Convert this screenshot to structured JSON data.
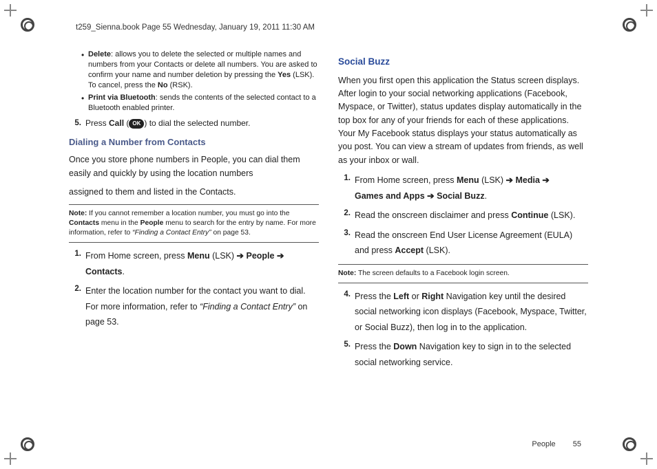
{
  "header": {
    "line": "t259_Sienna.book  Page 55  Wednesday, January 19, 2011  11:30 AM"
  },
  "left": {
    "bullets": [
      {
        "term": "Delete",
        "rest": ": allows you to delete the selected or multiple names and numbers from your Contacts or delete all numbers. You are asked to confirm your name and number deletion by pressing the ",
        "bold2": "Yes",
        "rest2": " (LSK). To cancel, press the ",
        "bold3": "No",
        "rest3": " (RSK)."
      },
      {
        "term": "Print via Bluetooth",
        "rest": ": sends the contents of the selected contact to a Bluetooth enabled printer."
      }
    ],
    "step5": {
      "num": "5.",
      "pre": "Press ",
      "bold": "Call",
      "mid": " (",
      "post": ") to dial the selected number."
    },
    "heading": "Dialing a Number from Contacts",
    "intro1": "Once you store phone numbers in People, you can dial them easily and quickly by using the location numbers",
    "intro2": "assigned to them and listed in the Contacts.",
    "note": {
      "label": "Note:",
      "text1": " If you cannot remember a location number, you must go into the ",
      "b1": "Contacts",
      "text2": " menu in the ",
      "b2": "People",
      "text3": " menu to search for the entry by name. For more information, refer to ",
      "ref": "“Finding a Contact Entry”",
      "text4": "  on page 53."
    },
    "steps": [
      {
        "num": "1.",
        "pre": "From Home screen, press ",
        "b1": "Menu",
        "mid1": " (LSK) ",
        "b2": "People",
        "mid2": " ",
        "b3": "Contacts",
        "post": "."
      },
      {
        "num": "2.",
        "text1": "Enter the location number for the contact you want to dial. For more information, refer to ",
        "ref": "“Finding a Contact Entry”",
        "text2": " on page 53."
      }
    ]
  },
  "right": {
    "heading": "Social Buzz",
    "intro": "When you first open this application the Status screen displays. After login to your social networking applications (Facebook, Myspace, or Twitter), status updates display automatically in the top box for any of your friends for each of these applications. Your My Facebook status displays your status automatically as you post. You can view a stream of updates from friends, as well as your inbox or wall.",
    "steps1": [
      {
        "num": "1.",
        "pre": "From Home screen, press ",
        "b1": "Menu",
        "mid1": " (LSK) ",
        "b2": "Media",
        "line2a": "Games and Apps",
        "line2b": "Social Buzz",
        "post": "."
      },
      {
        "num": "2.",
        "text": "Read the onscreen disclaimer and press ",
        "b": "Continue",
        "post": " (LSK)."
      },
      {
        "num": "3.",
        "text": "Read the onscreen End User License Agreement (EULA) and press ",
        "b": "Accept",
        "post": " (LSK)."
      }
    ],
    "note": {
      "label": "Note:",
      "text": " The screen defaults to a Facebook login screen."
    },
    "steps2": [
      {
        "num": "4.",
        "pre": "Press the ",
        "b1": "Left",
        "or": " or ",
        "b2": "Right",
        "post": " Navigation key until the desired social networking icon displays (Facebook, Myspace, Twitter, or Social Buzz), then log in to the application."
      },
      {
        "num": "5.",
        "pre": "Press the ",
        "b1": "Down",
        "post": " Navigation key to sign in to the selected social networking service."
      }
    ]
  },
  "footer": {
    "section": "People",
    "page": "55"
  },
  "glyph": {
    "arrow": "➔",
    "ok": "OK"
  }
}
